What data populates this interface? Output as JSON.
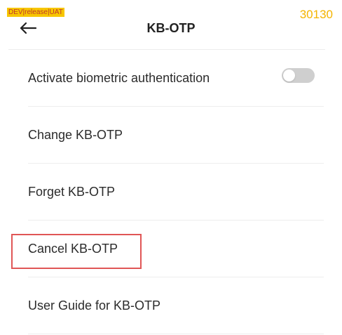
{
  "env_badge": "DEV|release|UAT",
  "build_number": "30130",
  "header": {
    "back_icon": "arrow-left-icon",
    "title": "KB-OTP"
  },
  "menu": {
    "items": [
      {
        "label": "Activate biometric authentication",
        "has_toggle": true,
        "toggle_on": false
      },
      {
        "label": "Change KB-OTP"
      },
      {
        "label": "Forget KB-OTP"
      },
      {
        "label": "Cancel KB-OTP",
        "highlighted": true
      },
      {
        "label": "User Guide for KB-OTP"
      }
    ]
  },
  "colors": {
    "badge_bg": "#f7c600",
    "build_number": "#f4b400",
    "toggle_off": "#cfcfcf",
    "highlight": "#e05656"
  }
}
